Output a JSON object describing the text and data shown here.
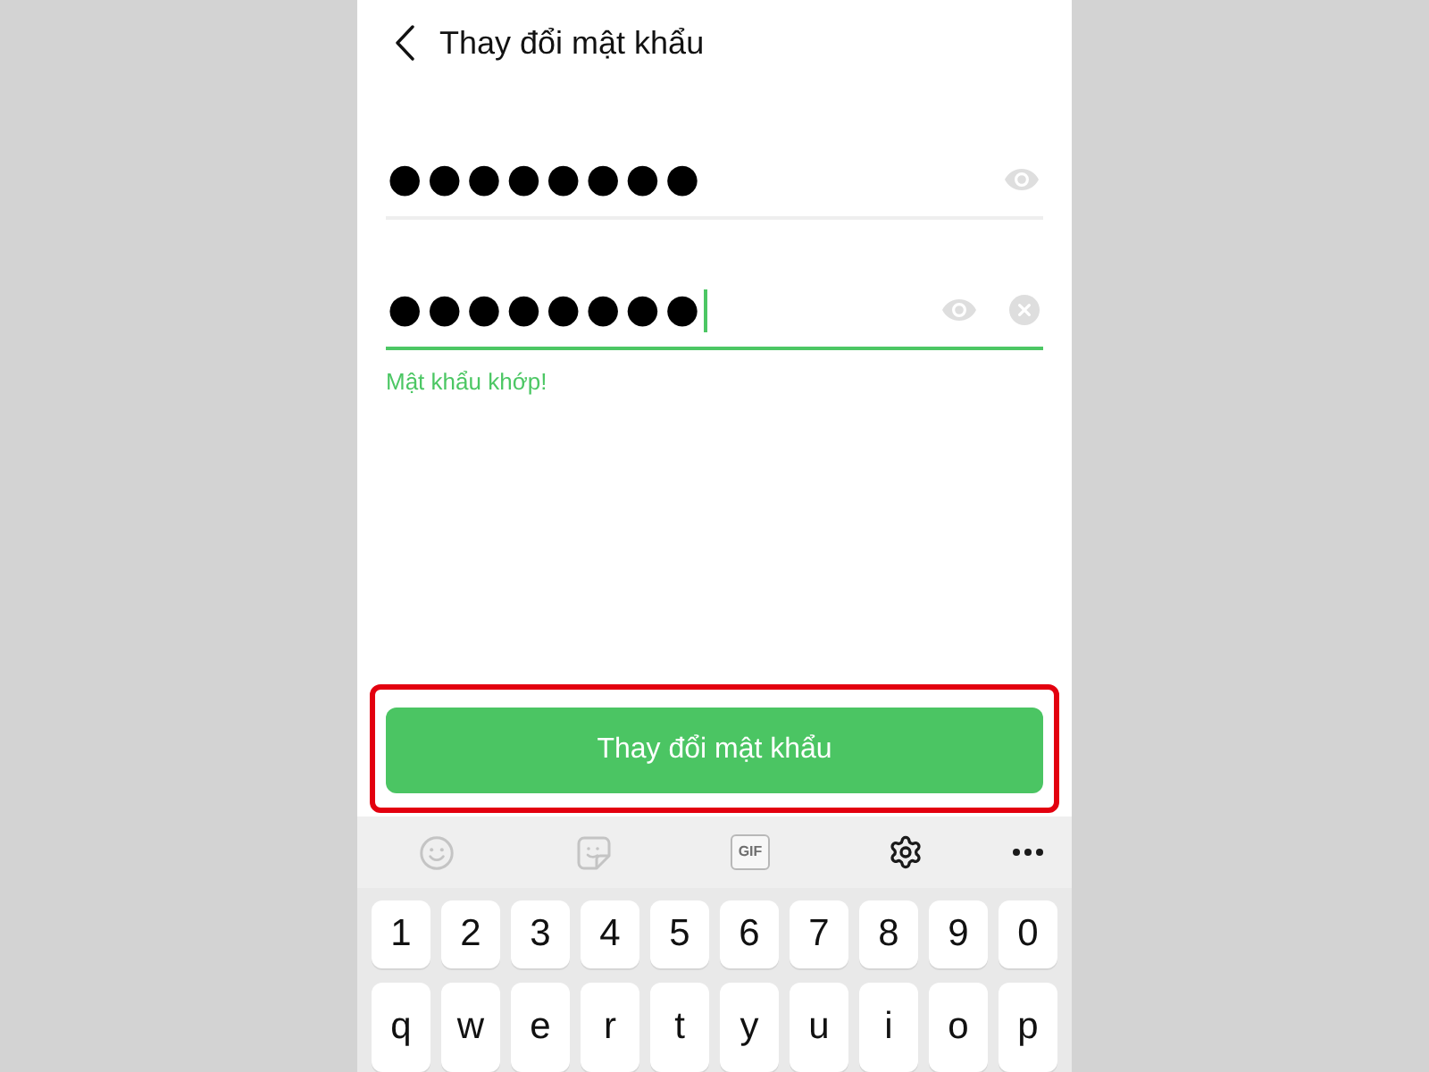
{
  "header": {
    "title": "Thay đổi mật khẩu"
  },
  "fields": [
    {
      "value": "●●●●●●●●",
      "focused": false,
      "clear_button": false
    },
    {
      "value": "●●●●●●●●",
      "focused": true,
      "clear_button": true
    }
  ],
  "match_message": "Mật khẩu khớp!",
  "submit_button": {
    "label": "Thay đổi mật khẩu",
    "highlighted": true
  },
  "keyboard": {
    "toolbar": [
      {
        "kind": "emoji",
        "disabled": true
      },
      {
        "kind": "sticker",
        "disabled": true
      },
      {
        "kind": "gif",
        "label": "GIF",
        "disabled": true
      },
      {
        "kind": "settings",
        "disabled": false
      },
      {
        "kind": "more",
        "disabled": false
      }
    ],
    "rows": [
      [
        "1",
        "2",
        "3",
        "4",
        "5",
        "6",
        "7",
        "8",
        "9",
        "0"
      ],
      [
        "q",
        "w",
        "e",
        "r",
        "t",
        "y",
        "u",
        "i",
        "o",
        "p"
      ]
    ]
  }
}
